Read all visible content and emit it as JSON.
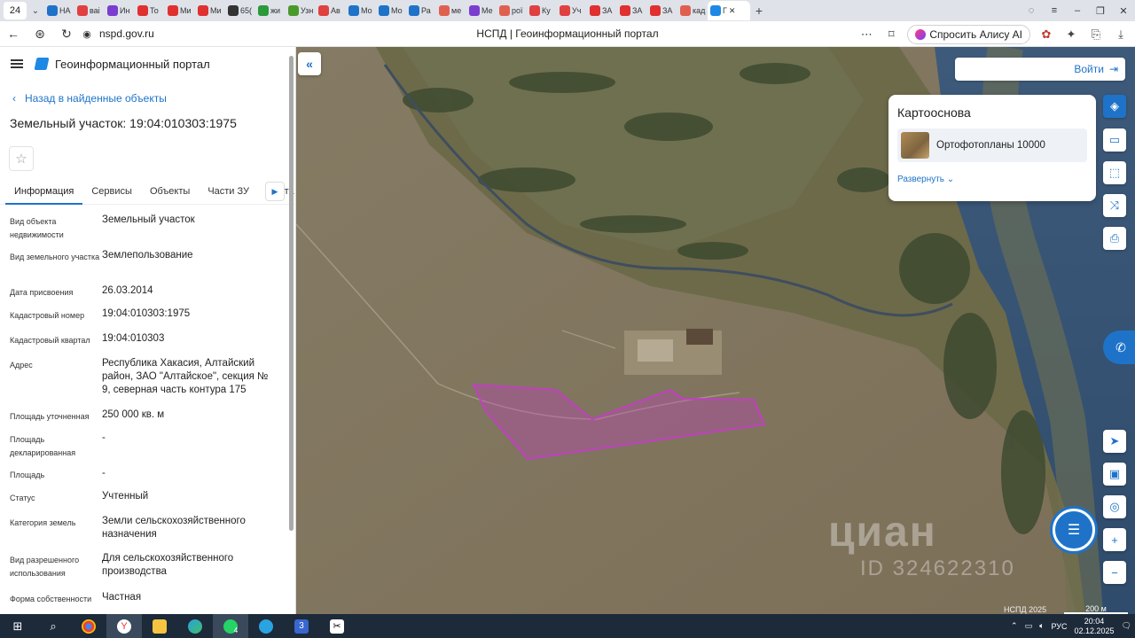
{
  "browser": {
    "tab_count": "24",
    "tabs": [
      {
        "label": "НА",
        "color": "#1e73c8"
      },
      {
        "label": "ваі",
        "color": "#e04040"
      },
      {
        "label": "Ин",
        "color": "#7a3dd0"
      },
      {
        "label": "То",
        "color": "#e03030"
      },
      {
        "label": "Ми",
        "color": "#e03030"
      },
      {
        "label": "Ми",
        "color": "#e03030"
      },
      {
        "label": "65(",
        "color": "#333333"
      },
      {
        "label": "жи",
        "color": "#2a9a3a"
      },
      {
        "label": "Узн",
        "color": "#4a9a2a"
      },
      {
        "label": "Ав",
        "color": "#e04040"
      },
      {
        "label": "Мо",
        "color": "#1e73c8"
      },
      {
        "label": "Мо",
        "color": "#1e73c8"
      },
      {
        "label": "Ра",
        "color": "#1e73c8"
      },
      {
        "label": "ме",
        "color": "#e06050"
      },
      {
        "label": "Ме",
        "color": "#7a3dd0"
      },
      {
        "label": "рої",
        "color": "#e06050"
      },
      {
        "label": "Ку",
        "color": "#e04040"
      },
      {
        "label": "Уч",
        "color": "#e04040"
      },
      {
        "label": "ЗА",
        "color": "#e03030"
      },
      {
        "label": "ЗА",
        "color": "#e03030"
      },
      {
        "label": "ЗА",
        "color": "#e03030"
      },
      {
        "label": "кад",
        "color": "#e06050"
      }
    ],
    "active_tab": "Г",
    "url": "nspd.gov.ru",
    "page_title": "НСПД | Геоинформационный портал",
    "alice_label": "Спросить Алису AI"
  },
  "app": {
    "title": "Геоинформационный портал",
    "back_label": "Назад в найденные объекты",
    "object_title": "Земельный участок: 19:04:010303:1975",
    "tabs": [
      "Информация",
      "Сервисы",
      "Объекты",
      "Части ЗУ",
      "Соста"
    ],
    "info": [
      {
        "key": "Вид объекта недвижимости",
        "value": "Земельный участок"
      },
      {
        "key": "Вид земельного участка",
        "value": "Землепользование"
      },
      {
        "key": "Дата присвоения",
        "value": "26.03.2014"
      },
      {
        "key": "Кадастровый номер",
        "value": "19:04:010303:1975"
      },
      {
        "key": "Кадастровый квартал",
        "value": "19:04:010303"
      },
      {
        "key": "Адрес",
        "value": "Республика Хакасия, Алтайский район, ЗАО \"Алтайское\", секция № 9, северная часть контура 175"
      },
      {
        "key": "Площадь уточненная",
        "value": "250 000 кв. м"
      },
      {
        "key": "Площадь декларированная",
        "value": "-"
      },
      {
        "key": "Площадь",
        "value": "-"
      },
      {
        "key": "Статус",
        "value": "Учтенный"
      },
      {
        "key": "Категория земель",
        "value": "Земли сельскохозяйственного назначения"
      },
      {
        "key": "Вид разрешенного использования",
        "value": "Для сельскохозяйственного производства"
      },
      {
        "key": "Форма собственности",
        "value": "Частная"
      }
    ]
  },
  "map": {
    "login_label": "Войти",
    "basemap_title": "Картооснова",
    "basemap_item": "Ортофотопланы 10000",
    "expand_label": "Развернуть",
    "watermark_brand": "циан",
    "watermark_id": "ID 324622310",
    "copyright": "НСПД 2025",
    "scale": "200 м",
    "parcel_color": "#c040c0"
  },
  "taskbar": {
    "badge_whatsapp": "4",
    "badge_max": "3",
    "lang": "РУС",
    "time": "20:04",
    "date": "02.12.2025"
  }
}
